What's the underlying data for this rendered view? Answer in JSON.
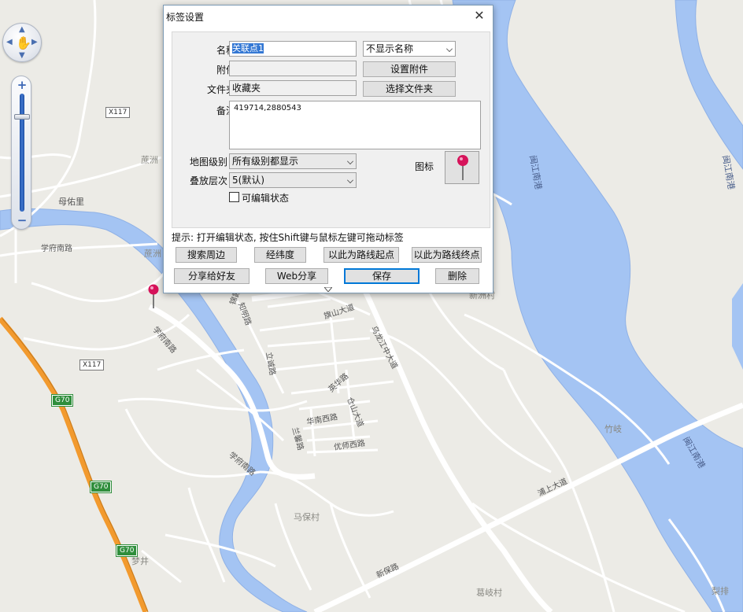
{
  "map": {
    "labels": {
      "x117_a": "X117",
      "x117_b": "X117",
      "luzhou_1": "蔗洲",
      "luzhou_2": "蔗洲",
      "muyouli": "母佑里",
      "xuefu_nanlu_1": "学府南路",
      "xuefu_nanlu_2": "学府南路",
      "xuefu_nanlu_3": "学府南路",
      "minjiang_nangang_1": "闽江南港",
      "minjiang_nangang_2": "闽江南港",
      "minjiang_nangang_3": "闽江南港",
      "zhiming_lu": "知明路",
      "qishan_dadao": "旗山大道",
      "wulongjiang_zhongdadao": "乌龙江中大道",
      "lifeng_lu": "立诚路",
      "yinghua_lu": "英华路",
      "cangshan_dadao": "仓山大道",
      "huanan_xilu": "华南西路",
      "lanxin_lu": "兰馨路",
      "youshi_xilu": "优师西路",
      "pushang_dadao": "浦上大道",
      "xinbao_lu": "新保路",
      "mabao_cun": "马保村",
      "zhuqi": "竹岐",
      "geqi_cun": "葛岐村",
      "xinzhou_cun": "新洲村",
      "liping": "梨排",
      "mengjing": "梦井",
      "jiang_road": "锦霞路",
      "g70_1": "G70",
      "g70_2": "G70",
      "g70_3": "G70"
    }
  },
  "dialog": {
    "title": "标签设置",
    "name_label": "名称",
    "name_value": "关联点1",
    "display_mode": "不显示名称",
    "attach_label": "附件",
    "attach_value": "",
    "set_attach_button": "设置附件",
    "folder_label": "文件夹",
    "folder_value": "收藏夹",
    "choose_folder_button": "选择文件夹",
    "note_label": "备注",
    "note_value": "419714,2880543",
    "map_level_label": "地图级别",
    "map_level_value": "所有级别都显示",
    "layer_label": "叠放层次",
    "layer_value": "5(默认)",
    "editable_label": "可编辑状态",
    "icon_label": "图标",
    "hint": "提示: 打开编辑状态, 按住Shift键与鼠标左键可拖动标签",
    "buttons": {
      "search_nearby": "搜索周边",
      "coordinates": "经纬度",
      "route_start": "以此为路线起点",
      "route_end": "以此为路线终点",
      "share_friends": "分享给好友",
      "web_share": "Web分享",
      "save": "保存",
      "delete": "删除"
    }
  },
  "colors": {
    "water": "#a4c4f3",
    "highway": "#f29a2e",
    "road": "#ffffff",
    "land": "#ecebe6",
    "pin": "#d6135a"
  }
}
